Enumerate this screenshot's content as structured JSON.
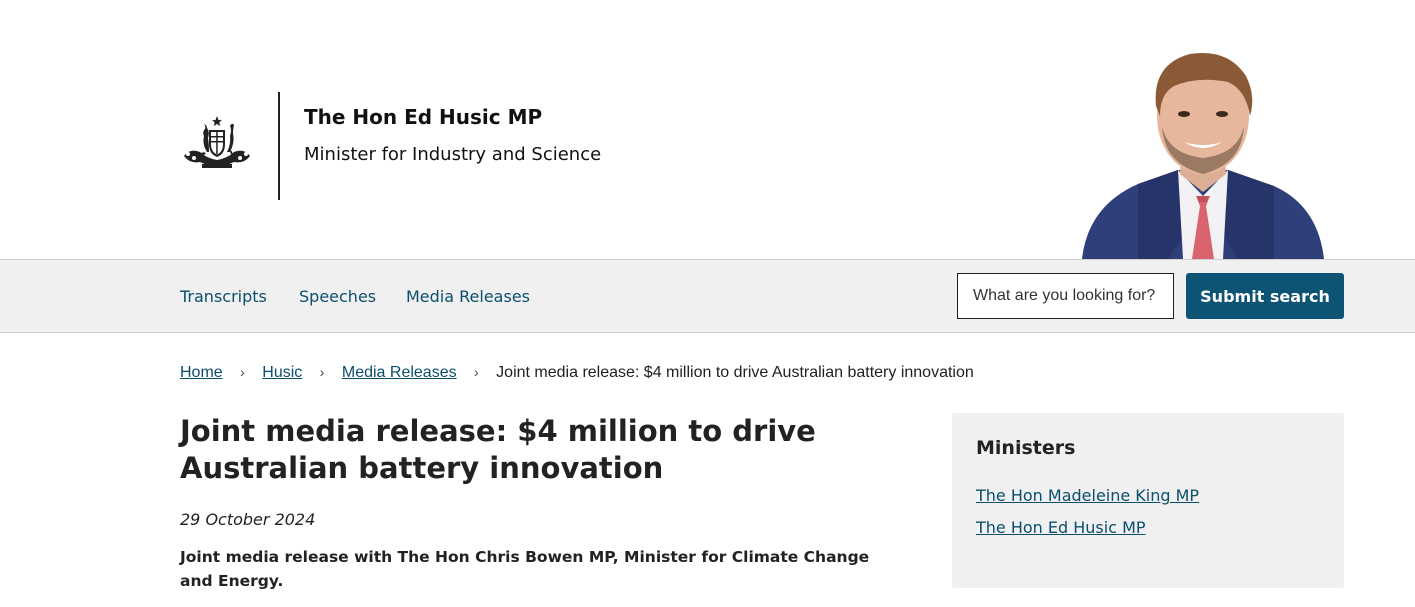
{
  "header": {
    "minister_name": "The Hon Ed Husic MP",
    "minister_role": "Minister for Industry and Science"
  },
  "nav": {
    "items": [
      {
        "label": "Transcripts"
      },
      {
        "label": "Speeches"
      },
      {
        "label": "Media Releases"
      }
    ],
    "search": {
      "placeholder": "What are you looking for?",
      "value": "",
      "button_label": "Submit search"
    }
  },
  "breadcrumb": {
    "items": [
      {
        "label": "Home"
      },
      {
        "label": "Husic"
      },
      {
        "label": "Media Releases"
      }
    ],
    "separator": "›",
    "current": "Joint media release: $4 million to drive Australian battery innovation"
  },
  "article": {
    "title": "Joint media release: $4 million to drive Australian battery innovation",
    "date": "29 October 2024",
    "subtitle": "Joint media release with The Hon Chris Bowen MP, Minister for Climate Change and Energy."
  },
  "sidebar": {
    "title": "Ministers",
    "links": [
      {
        "label": "The Hon Madeleine King MP"
      },
      {
        "label": "The Hon Ed Husic MP"
      }
    ]
  },
  "colors": {
    "link": "#0b4f6c",
    "button": "#0d5373",
    "nav_background": "#f0f0f0",
    "sidebar_background": "#f0f0f0"
  },
  "icons": {
    "crest": "coat-of-arms-icon",
    "portrait": "minister-portrait-image"
  }
}
